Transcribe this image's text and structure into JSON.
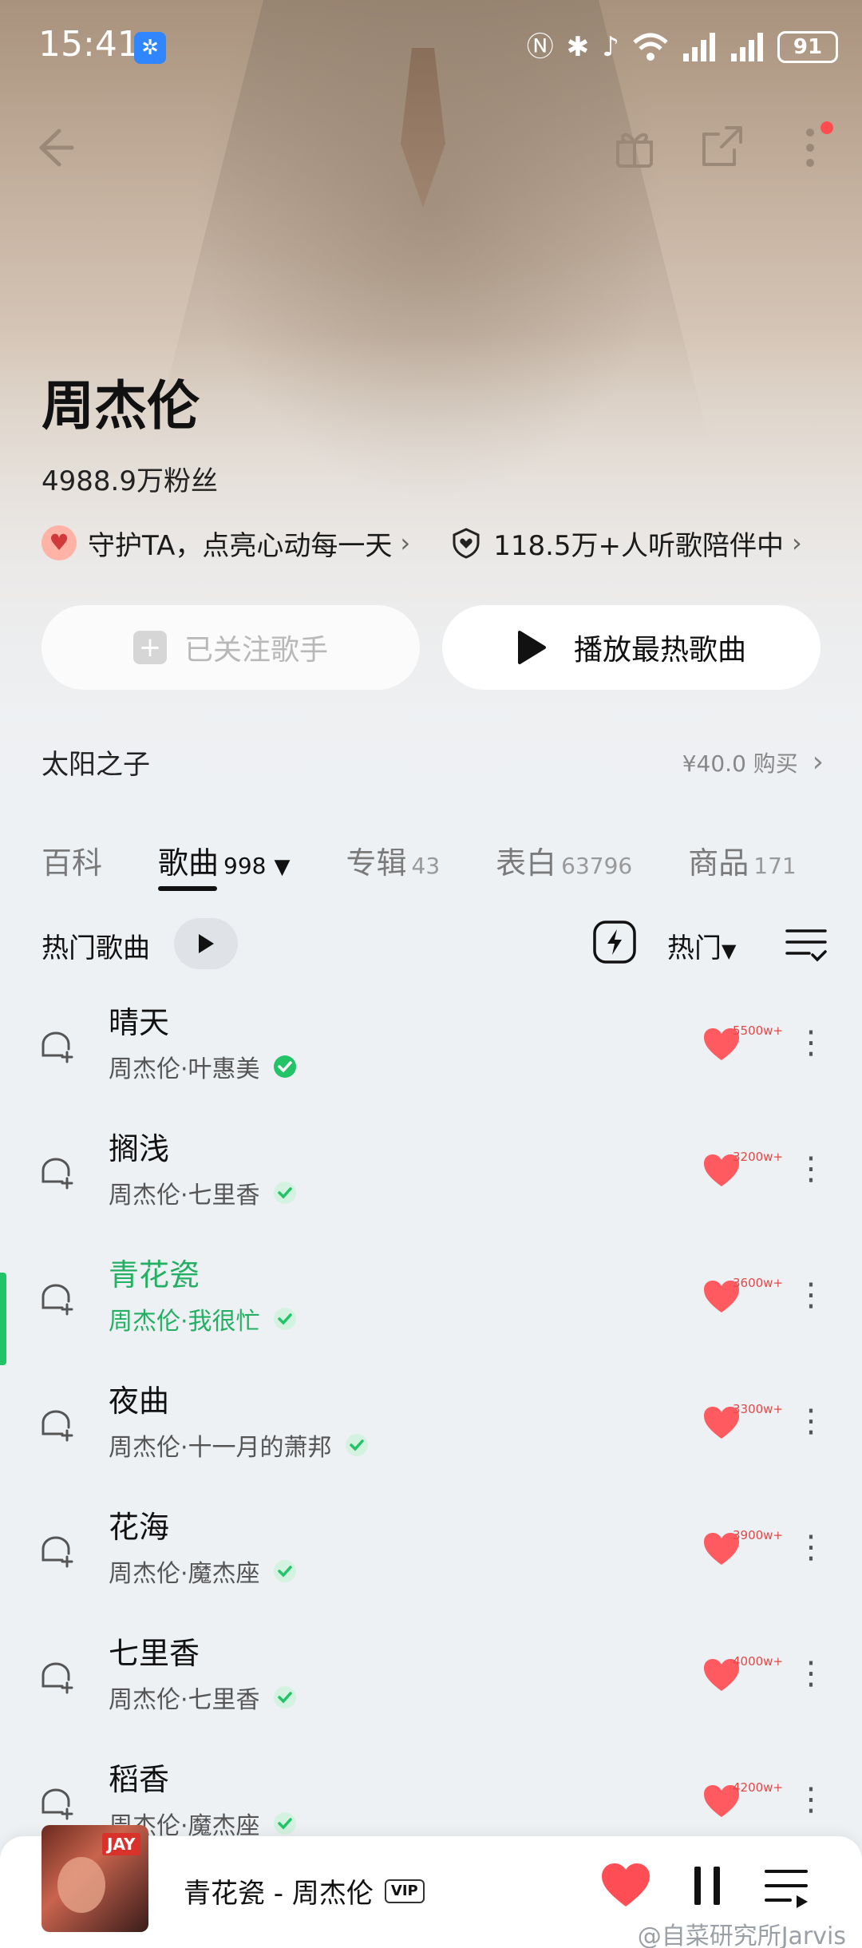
{
  "status_bar": {
    "time": "15:41",
    "battery": "91",
    "icons": [
      "nfc-icon",
      "bluetooth-icon",
      "mute-icon",
      "wifi-icon",
      "signal-icon",
      "signal-icon"
    ]
  },
  "artist": {
    "name": "周杰伦",
    "fans": "4988.9万粉丝",
    "guard_text": "守护TA，点亮心动每一天",
    "listeners_text": "118.5万+人听歌陪伴中"
  },
  "buttons": {
    "follow_label": "已关注歌手",
    "play_hot_label": "播放最热歌曲"
  },
  "album": {
    "title": "太阳之子",
    "price": "¥40.0 购买"
  },
  "tabs": [
    {
      "label": "百科",
      "count": ""
    },
    {
      "label": "歌曲",
      "count": "998"
    },
    {
      "label": "专辑",
      "count": "43"
    },
    {
      "label": "表白",
      "count": "63796"
    },
    {
      "label": "商品",
      "count": "171"
    }
  ],
  "list_header": {
    "hot_label": "热门歌曲",
    "sort_label": "热门"
  },
  "songs": [
    {
      "title": "晴天",
      "subtitle": "周杰伦·叶惠美",
      "likes": "5500w+"
    },
    {
      "title": "搁浅",
      "subtitle": "周杰伦·七里香",
      "likes": "3200w+"
    },
    {
      "title": "青花瓷",
      "subtitle": "周杰伦·我很忙",
      "likes": "3600w+"
    },
    {
      "title": "夜曲",
      "subtitle": "周杰伦·十一月的萧邦",
      "likes": "3300w+"
    },
    {
      "title": "花海",
      "subtitle": "周杰伦·魔杰座",
      "likes": "3900w+"
    },
    {
      "title": "七里香",
      "subtitle": "周杰伦·七里香",
      "likes": "4000w+"
    },
    {
      "title": "稻香",
      "subtitle": "周杰伦·魔杰座",
      "likes": "4200w+"
    }
  ],
  "mini_player": {
    "title": "青花瓷 - 周杰伦",
    "vip": "VIP",
    "cover_text": "JAY"
  },
  "watermark": "@自菜研究所Jarvis",
  "colors": {
    "accent_green": "#23c367",
    "heart_red": "#ff5a5f"
  }
}
